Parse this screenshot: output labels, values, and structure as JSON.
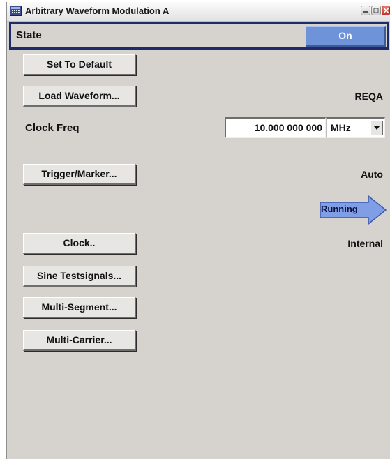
{
  "window": {
    "title": "Arbitrary Waveform Modulation  A",
    "icon": "waveform-app-icon"
  },
  "state": {
    "label": "State",
    "value": "On"
  },
  "buttons": {
    "set_to_default": "Set To Default",
    "load_waveform": "Load Waveform...",
    "trigger_marker": "Trigger/Marker...",
    "clock": "Clock..",
    "sine_testsignals": "Sine Testsignals...",
    "multi_segment": "Multi-Segment...",
    "multi_carrier": "Multi-Carrier..."
  },
  "values": {
    "waveform_name": "REQA",
    "trigger_mode": "Auto",
    "run_status": "Running",
    "clock_source": "Internal"
  },
  "clock_freq": {
    "label": "Clock Freq",
    "value": "10.000 000 000",
    "unit": "MHz"
  },
  "colors": {
    "panel_bg": "#d6d3ce",
    "on_button": "#6f93d8",
    "running_arrow": "#7f9ee6",
    "focus_border": "#1f2a6b"
  }
}
